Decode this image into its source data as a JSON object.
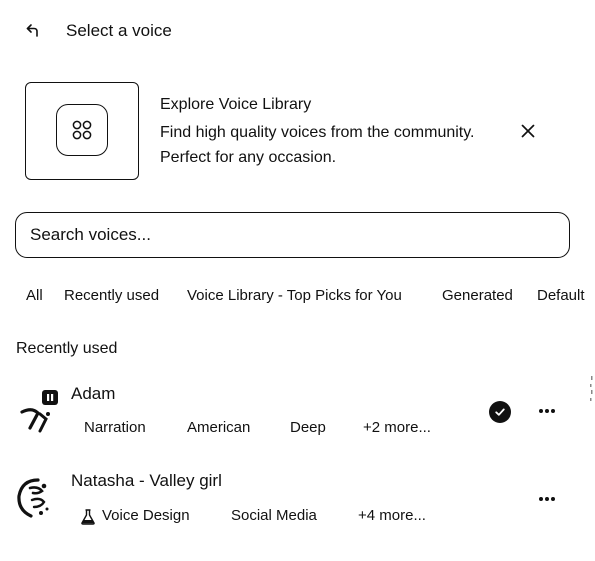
{
  "header": {
    "title": "Select a voice",
    "back_icon": "back-arrow-icon"
  },
  "banner": {
    "title": "Explore Voice Library",
    "description": "Find high quality voices from the community. Perfect for any occasion.",
    "icon": "grid-icon",
    "close_icon": "close-icon"
  },
  "search": {
    "placeholder": "Search voices...",
    "value": ""
  },
  "filters": [
    {
      "label": "All"
    },
    {
      "label": "Recently used"
    },
    {
      "label": "Voice Library - Top Picks for You"
    },
    {
      "label": "Generated"
    },
    {
      "label": "Default"
    }
  ],
  "section": {
    "title": "Recently used"
  },
  "voices": [
    {
      "name": "Adam",
      "tags": [
        "Narration",
        "American",
        "Deep",
        "+2 more..."
      ],
      "selected": true
    },
    {
      "name": "Natasha - Valley girl",
      "tags": [
        "Voice Design",
        "Social Media",
        "+4 more..."
      ],
      "selected": false
    }
  ]
}
